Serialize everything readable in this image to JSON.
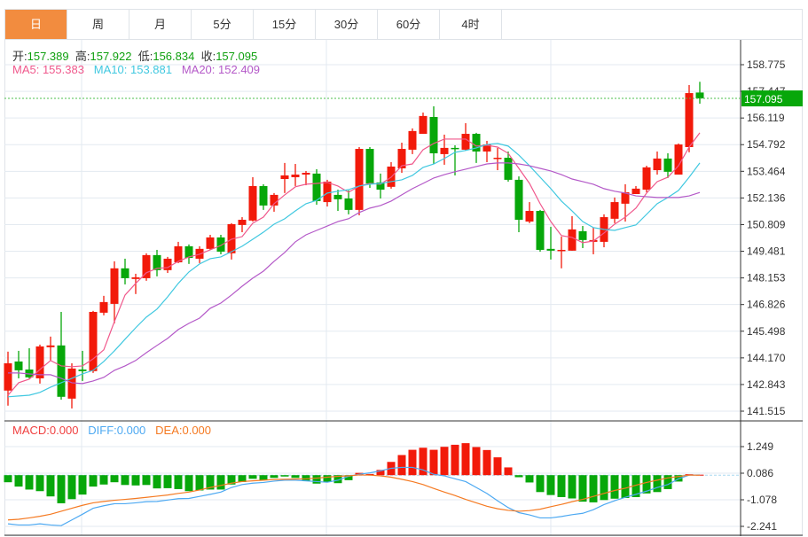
{
  "tabs": [
    "日",
    "周",
    "月",
    "5分",
    "15分",
    "30分",
    "60分",
    "4时"
  ],
  "active_tab": 0,
  "ohlc_legend": {
    "open_label": "开:",
    "open": "157.389",
    "high_label": "高:",
    "high": "157.922",
    "low_label": "低:",
    "low": "156.834",
    "close_label": "收:",
    "close": "157.095"
  },
  "ma_legend": {
    "ma5": "MA5: 155.383",
    "ma10": "MA10: 153.881",
    "ma20": "MA20: 152.409"
  },
  "macd_legend": {
    "macd": "MACD:0.000",
    "diff": "DIFF:0.000",
    "dea": "DEA:0.000"
  },
  "current_price": "157.095",
  "colors": {
    "up": "#f21a0a",
    "down": "#07a70a",
    "ma5": "#f0588c",
    "ma10": "#40c8e0",
    "ma20": "#b459c8",
    "diff": "#4da9f2",
    "dea": "#f57a22",
    "tab_active": "#f28c3f",
    "price_label_bg": "#07a70a"
  },
  "chart_data": [
    {
      "type": "candlestick",
      "convention": "red = up, green = down",
      "y_ticks": [
        "158.775",
        "157.447",
        "156.119",
        "154.792",
        "153.464",
        "152.136",
        "150.809",
        "149.481",
        "148.153",
        "146.826",
        "145.498",
        "144.170",
        "142.843",
        "141.515"
      ],
      "ylim": [
        141.515,
        158.775
      ],
      "grid": true,
      "candles_ohlc": [
        [
          142.54,
          144.48,
          141.79,
          143.9
        ],
        [
          143.99,
          144.52,
          143.15,
          143.55
        ],
        [
          143.59,
          144.65,
          143.15,
          143.2
        ],
        [
          143.15,
          144.83,
          142.89,
          144.74
        ],
        [
          144.7,
          145.23,
          144.04,
          144.79
        ],
        [
          144.79,
          146.46,
          142.09,
          142.23
        ],
        [
          142.14,
          143.9,
          141.65,
          143.64
        ],
        [
          143.59,
          144.52,
          143.02,
          143.51
        ],
        [
          143.51,
          146.51,
          143.42,
          146.46
        ],
        [
          146.42,
          147.26,
          146.29,
          146.95
        ],
        [
          146.86,
          148.98,
          145.89,
          148.63
        ],
        [
          148.63,
          149.11,
          147.83,
          148.14
        ],
        [
          148.1,
          148.36,
          147.35,
          148.18
        ],
        [
          148.14,
          149.38,
          148.01,
          149.29
        ],
        [
          149.29,
          149.55,
          148.23,
          148.54
        ],
        [
          148.54,
          149.2,
          148.4,
          149.11
        ],
        [
          148.93,
          149.95,
          148.89,
          149.73
        ],
        [
          149.73,
          149.82,
          148.85,
          149.15
        ],
        [
          149.11,
          149.73,
          148.89,
          149.6
        ],
        [
          149.6,
          150.3,
          149.55,
          150.17
        ],
        [
          150.17,
          150.3,
          149.33,
          149.46
        ],
        [
          149.38,
          150.88,
          149.07,
          150.83
        ],
        [
          150.79,
          151.18,
          150.43,
          151.05
        ],
        [
          151.01,
          153.17,
          150.96,
          152.73
        ],
        [
          152.73,
          152.82,
          151.54,
          151.76
        ],
        [
          151.76,
          152.38,
          151.45,
          152.29
        ],
        [
          153.08,
          153.88,
          152.38,
          153.26
        ],
        [
          153.17,
          153.83,
          152.73,
          153.3
        ],
        [
          153.3,
          153.48,
          152.77,
          153.39
        ],
        [
          153.35,
          153.57,
          151.8,
          151.98
        ],
        [
          151.93,
          153.04,
          151.71,
          152.95
        ],
        [
          152.29,
          152.55,
          151.49,
          152.07
        ],
        [
          152.11,
          152.51,
          151.32,
          151.54
        ],
        [
          151.54,
          154.67,
          151.27,
          154.58
        ],
        [
          154.58,
          154.67,
          152.64,
          152.86
        ],
        [
          152.91,
          153.35,
          152.11,
          152.55
        ],
        [
          152.69,
          153.92,
          152.6,
          153.7
        ],
        [
          153.61,
          154.89,
          153.39,
          154.58
        ],
        [
          154.54,
          155.6,
          154.32,
          155.47
        ],
        [
          155.33,
          156.39,
          155.33,
          156.22
        ],
        [
          156.17,
          156.7,
          153.83,
          154.36
        ],
        [
          154.32,
          155.29,
          153.79,
          154.63
        ],
        [
          154.63,
          154.76,
          153.26,
          154.58
        ],
        [
          154.54,
          155.86,
          154.5,
          155.33
        ],
        [
          155.33,
          155.38,
          153.88,
          154.45
        ],
        [
          154.45,
          154.98,
          153.92,
          154.8
        ],
        [
          154.1,
          154.63,
          153.52,
          154.14
        ],
        [
          154.14,
          154.45,
          152.95,
          153.04
        ],
        [
          153.04,
          153.21,
          150.43,
          151.05
        ],
        [
          150.96,
          151.93,
          150.88,
          151.49
        ],
        [
          151.49,
          151.54,
          149.46,
          149.55
        ],
        [
          149.6,
          150.7,
          149.07,
          149.51
        ],
        [
          149.51,
          150.21,
          148.63,
          149.55
        ],
        [
          149.51,
          151.23,
          149.51,
          150.57
        ],
        [
          150.48,
          150.74,
          149.64,
          150.04
        ],
        [
          149.95,
          150.66,
          149.33,
          150.04
        ],
        [
          149.95,
          151.32,
          149.68,
          151.18
        ],
        [
          151.1,
          152.16,
          150.88,
          151.93
        ],
        [
          151.85,
          152.82,
          150.96,
          152.42
        ],
        [
          152.33,
          152.73,
          152.33,
          152.6
        ],
        [
          152.55,
          153.74,
          152.42,
          153.66
        ],
        [
          153.52,
          154.45,
          153.3,
          154.1
        ],
        [
          154.1,
          154.36,
          153.13,
          153.44
        ],
        [
          153.3,
          154.85,
          153.3,
          154.8
        ],
        [
          154.67,
          157.76,
          154.41,
          157.36
        ],
        [
          157.389,
          157.922,
          156.834,
          157.095
        ]
      ],
      "series": [
        {
          "name": "MA5",
          "values": [
            142.31,
            142.93,
            143.11,
            143.59,
            144.04,
            143.77,
            143.73,
            143.77,
            144.12,
            144.57,
            145.98,
            147.3,
            147.88,
            148.41,
            148.63,
            148.67,
            148.98,
            149.2,
            149.33,
            149.55,
            149.77,
            150.08,
            150.21,
            150.88,
            151.18,
            151.85,
            152.29,
            152.69,
            152.82,
            152.86,
            152.91,
            152.73,
            152.42,
            152.73,
            152.86,
            152.82,
            153.17,
            153.74,
            153.83,
            154.54,
            154.85,
            155.07,
            155.07,
            155.07,
            154.72,
            154.76,
            154.67,
            154.36,
            153.61,
            152.86,
            151.85,
            150.96,
            150.26,
            150.17,
            149.91,
            149.99,
            150.39,
            150.83,
            151.18,
            151.63,
            152.38,
            152.95,
            153.17,
            153.74,
            154.67,
            155.383
          ]
        },
        {
          "name": "MA10",
          "values": [
            142.23,
            142.27,
            142.31,
            142.45,
            142.71,
            142.93,
            143.15,
            143.37,
            143.55,
            143.99,
            144.52,
            145.1,
            145.67,
            146.2,
            146.6,
            147.21,
            147.88,
            148.45,
            148.85,
            149.11,
            149.2,
            149.46,
            149.73,
            150.08,
            150.43,
            150.83,
            151.1,
            151.49,
            151.85,
            152.02,
            152.38,
            152.47,
            152.55,
            152.73,
            152.82,
            152.86,
            152.95,
            153.04,
            153.26,
            153.66,
            153.83,
            154.1,
            154.41,
            154.5,
            154.63,
            154.8,
            154.85,
            154.72,
            154.27,
            153.74,
            153.17,
            152.6,
            151.98,
            151.49,
            150.96,
            150.66,
            150.57,
            150.52,
            150.66,
            150.79,
            151.32,
            151.85,
            152.16,
            152.51,
            153.17,
            153.881
          ]
        },
        {
          "name": "MA20",
          "values": [
            143.42,
            143.42,
            143.37,
            143.33,
            143.33,
            143.15,
            142.93,
            142.89,
            143.02,
            143.2,
            143.55,
            143.77,
            144.04,
            144.43,
            144.79,
            145.14,
            145.58,
            145.89,
            146.15,
            146.64,
            146.9,
            147.3,
            147.74,
            148.14,
            148.49,
            148.98,
            149.42,
            149.95,
            150.3,
            150.52,
            150.74,
            150.96,
            151.1,
            151.41,
            151.63,
            151.76,
            151.98,
            152.29,
            152.6,
            152.86,
            153.13,
            153.3,
            153.44,
            153.57,
            153.7,
            153.83,
            153.88,
            153.88,
            153.83,
            153.74,
            153.61,
            153.48,
            153.3,
            153.08,
            152.95,
            152.82,
            152.6,
            152.47,
            152.38,
            152.24,
            152.2,
            152.16,
            152.16,
            152.16,
            152.24,
            152.409
          ]
        }
      ]
    },
    {
      "type": "macd",
      "y_ticks": [
        "1.249",
        "0.086",
        "-1.078",
        "-2.241"
      ],
      "ylim": [
        -2.241,
        1.249
      ],
      "grid": true,
      "histogram": [
        -0.31,
        -0.5,
        -0.63,
        -0.7,
        -0.93,
        -1.23,
        -1.05,
        -0.85,
        -0.5,
        -0.41,
        -0.31,
        -0.43,
        -0.45,
        -0.43,
        -0.58,
        -0.57,
        -0.61,
        -0.7,
        -0.67,
        -0.63,
        -0.63,
        -0.41,
        -0.3,
        -0.16,
        -0.22,
        -0.12,
        -0.06,
        -0.12,
        -0.25,
        -0.37,
        -0.3,
        -0.35,
        -0.22,
        0.1,
        0.05,
        0.23,
        0.58,
        0.88,
        1.11,
        1.2,
        1.11,
        1.24,
        1.33,
        1.4,
        1.23,
        1.1,
        0.78,
        0.34,
        -0.09,
        -0.32,
        -0.74,
        -0.87,
        -0.96,
        -1.02,
        -1.16,
        -1.19,
        -1.09,
        -1.03,
        -1.0,
        -0.96,
        -0.8,
        -0.74,
        -0.61,
        -0.28,
        0.04,
        0.02
      ],
      "series": [
        {
          "name": "DIFF",
          "values": [
            -2.13,
            -2.18,
            -2.18,
            -2.13,
            -2.18,
            -2.21,
            -1.96,
            -1.71,
            -1.45,
            -1.34,
            -1.25,
            -1.25,
            -1.21,
            -1.16,
            -1.15,
            -1.09,
            -1.03,
            -1.02,
            -0.93,
            -0.84,
            -0.74,
            -0.54,
            -0.41,
            -0.35,
            -0.32,
            -0.26,
            -0.22,
            -0.22,
            -0.25,
            -0.28,
            -0.31,
            -0.22,
            -0.05,
            0.04,
            0.1,
            0.19,
            0.3,
            0.34,
            0.34,
            0.23,
            0.04,
            -0.03,
            -0.16,
            -0.28,
            -0.54,
            -0.8,
            -1.12,
            -1.42,
            -1.64,
            -1.74,
            -1.87,
            -1.87,
            -1.81,
            -1.73,
            -1.67,
            -1.51,
            -1.29,
            -1.12,
            -0.97,
            -0.84,
            -0.7,
            -0.54,
            -0.41,
            -0.16,
            0.0,
            0.01
          ]
        },
        {
          "name": "DEA",
          "values": [
            -1.96,
            -1.93,
            -1.87,
            -1.8,
            -1.71,
            -1.58,
            -1.45,
            -1.32,
            -1.21,
            -1.15,
            -1.1,
            -1.06,
            -1.02,
            -0.97,
            -0.92,
            -0.87,
            -0.8,
            -0.74,
            -0.65,
            -0.54,
            -0.45,
            -0.35,
            -0.28,
            -0.25,
            -0.22,
            -0.19,
            -0.18,
            -0.17,
            -0.16,
            -0.13,
            -0.09,
            -0.05,
            -0.03,
            0.01,
            0.0,
            -0.03,
            -0.09,
            -0.18,
            -0.28,
            -0.41,
            -0.58,
            -0.74,
            -0.89,
            -1.06,
            -1.21,
            -1.36,
            -1.47,
            -1.54,
            -1.58,
            -1.55,
            -1.49,
            -1.38,
            -1.28,
            -1.16,
            -1.06,
            -0.93,
            -0.8,
            -0.67,
            -0.57,
            -0.44,
            -0.32,
            -0.22,
            -0.12,
            -0.06,
            0.0,
            0.0
          ]
        }
      ]
    }
  ]
}
